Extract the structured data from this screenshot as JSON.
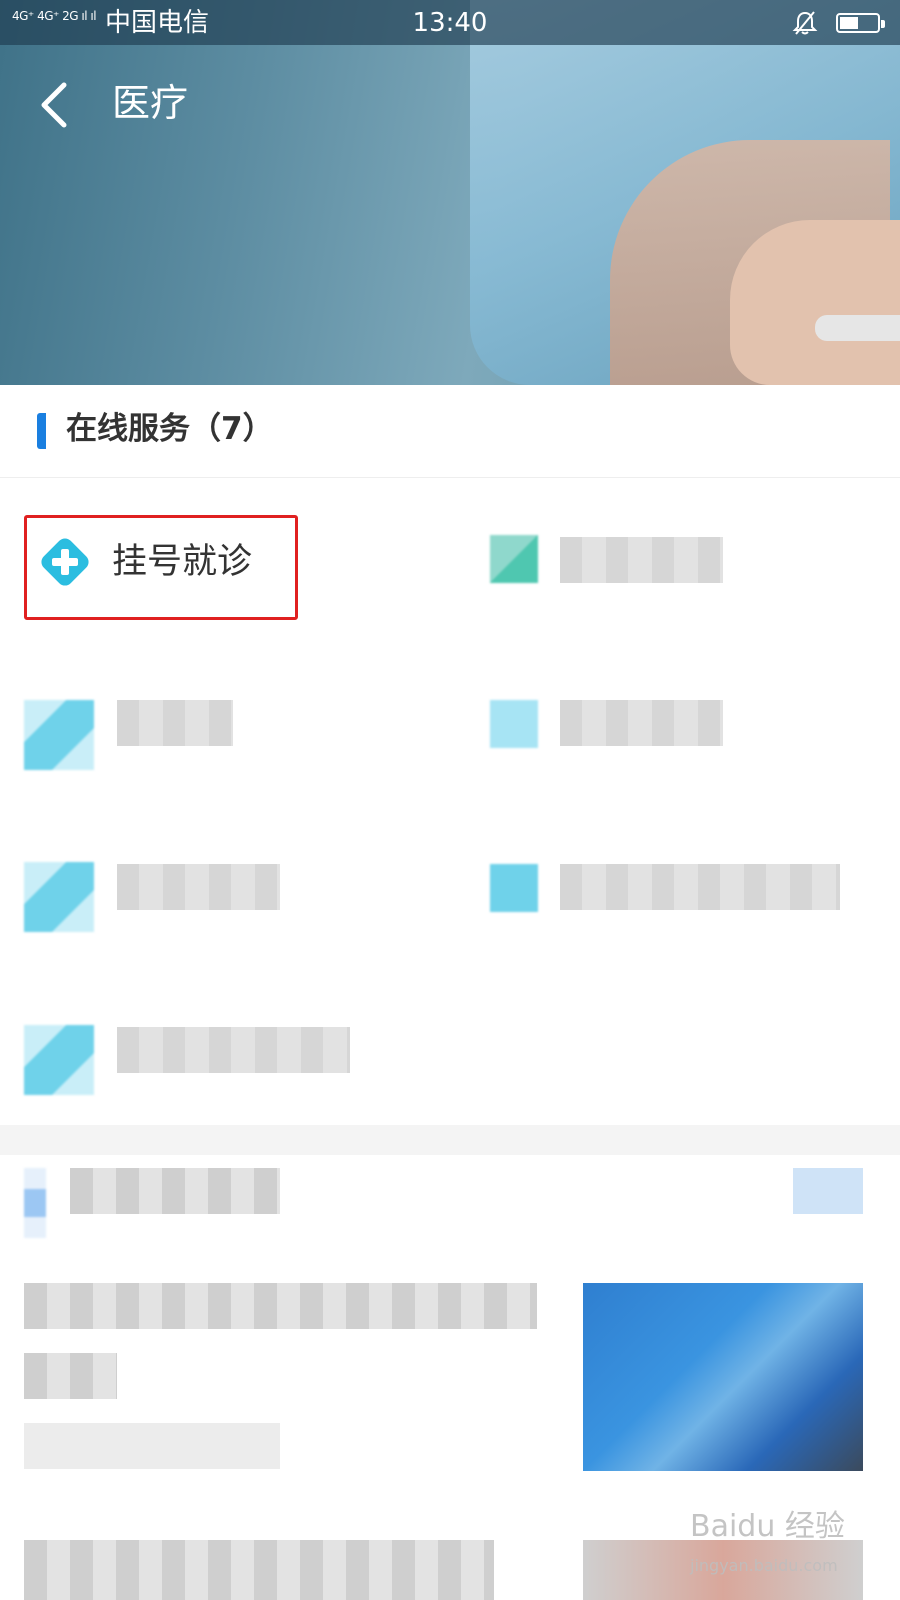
{
  "status_bar": {
    "signal": "4G⁺ 4G⁺ 2G ıl ıl",
    "carrier": "中国电信",
    "time": "13:40"
  },
  "header": {
    "title": "医疗"
  },
  "section": {
    "title": "在线服务（7）"
  },
  "services": [
    {
      "label": "挂号就诊",
      "icon": "medical-cross-icon"
    }
  ],
  "colors": {
    "accent_blue": "#1a7fe0",
    "highlight_red": "#e02020",
    "icon_cyan": "#2bbde0"
  },
  "watermark": {
    "brand": "Baidu 经验",
    "url": "jingyan.baidu.com"
  }
}
